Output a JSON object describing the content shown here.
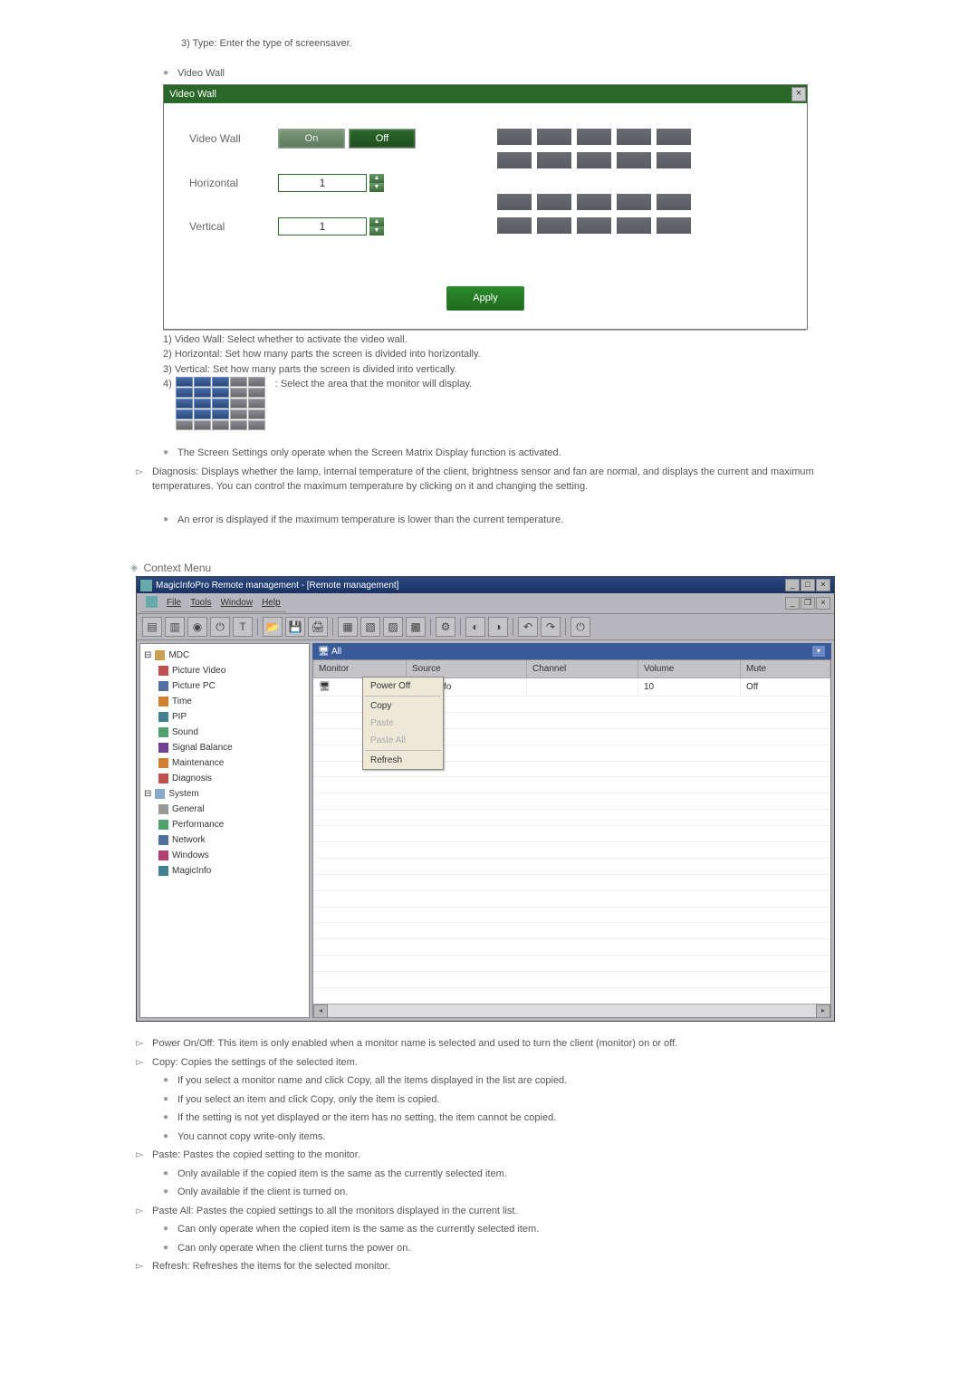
{
  "top": {
    "type_line": "3) Type: Enter the type of screensaver."
  },
  "videoWall": {
    "title": "Video Wall",
    "panelTitle": "Video Wall",
    "labels": {
      "vw": "Video Wall",
      "h": "Horizontal",
      "v": "Vertical"
    },
    "onLabel": "On",
    "offLabel": "Off",
    "h_value": "1",
    "v_value": "1",
    "apply": "Apply",
    "notes": {
      "n1": "1) Video Wall: Select whether to activate the video wall.",
      "n2": "2) Horizontal: Set how many parts the screen is divided into horizontally.",
      "n3": "3) Vertical: Set how many parts the screen is divided into vertically.",
      "n4a": "4)",
      "n4b": ": Select the area that the monitor will display."
    }
  },
  "screenSettingsNote": "The Screen Settings only operate when the Screen Matrix Display function is activated.",
  "diagnosis": "Diagnosis: Displays whether the lamp, internal temperature of the client, brightness sensor and fan are normal, and displays the current and maximum temperatures. You can control the maximum temperature by clicking on it and changing the setting.",
  "diagError": "An error is displayed if the maximum temperature is lower than the current temperature.",
  "contextMenu": {
    "title": "Context Menu",
    "appTitle": "MagicInfoPro Remote management - [Remote management]",
    "menu": {
      "file": "File",
      "tools": "Tools",
      "window": "Window",
      "help": "Help"
    },
    "tabLabel": "All",
    "headers": {
      "monitor": "Monitor",
      "source": "Source",
      "channel": "Channel",
      "volume": "Volume",
      "mute": "Mute"
    },
    "row": {
      "monitor": "",
      "source": "MagicInfo",
      "channel": "",
      "volume": "10",
      "mute": "Off"
    },
    "popup": {
      "powerOff": "Power Off",
      "copy": "Copy",
      "paste": "Paste",
      "pasteAll": "Paste All",
      "refresh": "Refresh"
    },
    "tree": {
      "root": "MDC",
      "items1": [
        "Picture Video",
        "Picture PC",
        "Time",
        "PIP",
        "Sound",
        "Signal Balance",
        "Maintenance",
        "Diagnosis"
      ],
      "sys": "System",
      "items2": [
        "General",
        "Performance",
        "Network",
        "Windows",
        "MagicInfo"
      ]
    }
  },
  "below": {
    "powerOnOff": "Power On/Off: This item is only enabled when a monitor name is selected and used to turn the client (monitor) on or off.",
    "copy": "Copy: Copies the settings of the selected item.",
    "copy_b1": "If you select a monitor name and click Copy, all the items displayed in the list are copied.",
    "copy_b2": "If you select an item and click Copy, only the item is copied.",
    "copy_b3": "If the setting is not yet displayed or the item has no setting, the item cannot be copied.",
    "copy_b4": "You cannot copy write-only items.",
    "paste": "Paste: Pastes the copied setting to the monitor.",
    "paste_b1": "Only available if the copied item is the same as the currently selected item.",
    "paste_b2": "Only available if the client is turned on.",
    "pasteAll": "Paste All: Pastes the copied settings to all the monitors displayed in the current list.",
    "pa_b1": "Can only operate when the copied item is the same as the currently selected item.",
    "pa_b2": "Can only operate when the client turns the power on.",
    "refresh": "Refresh: Refreshes the items for the selected monitor."
  }
}
